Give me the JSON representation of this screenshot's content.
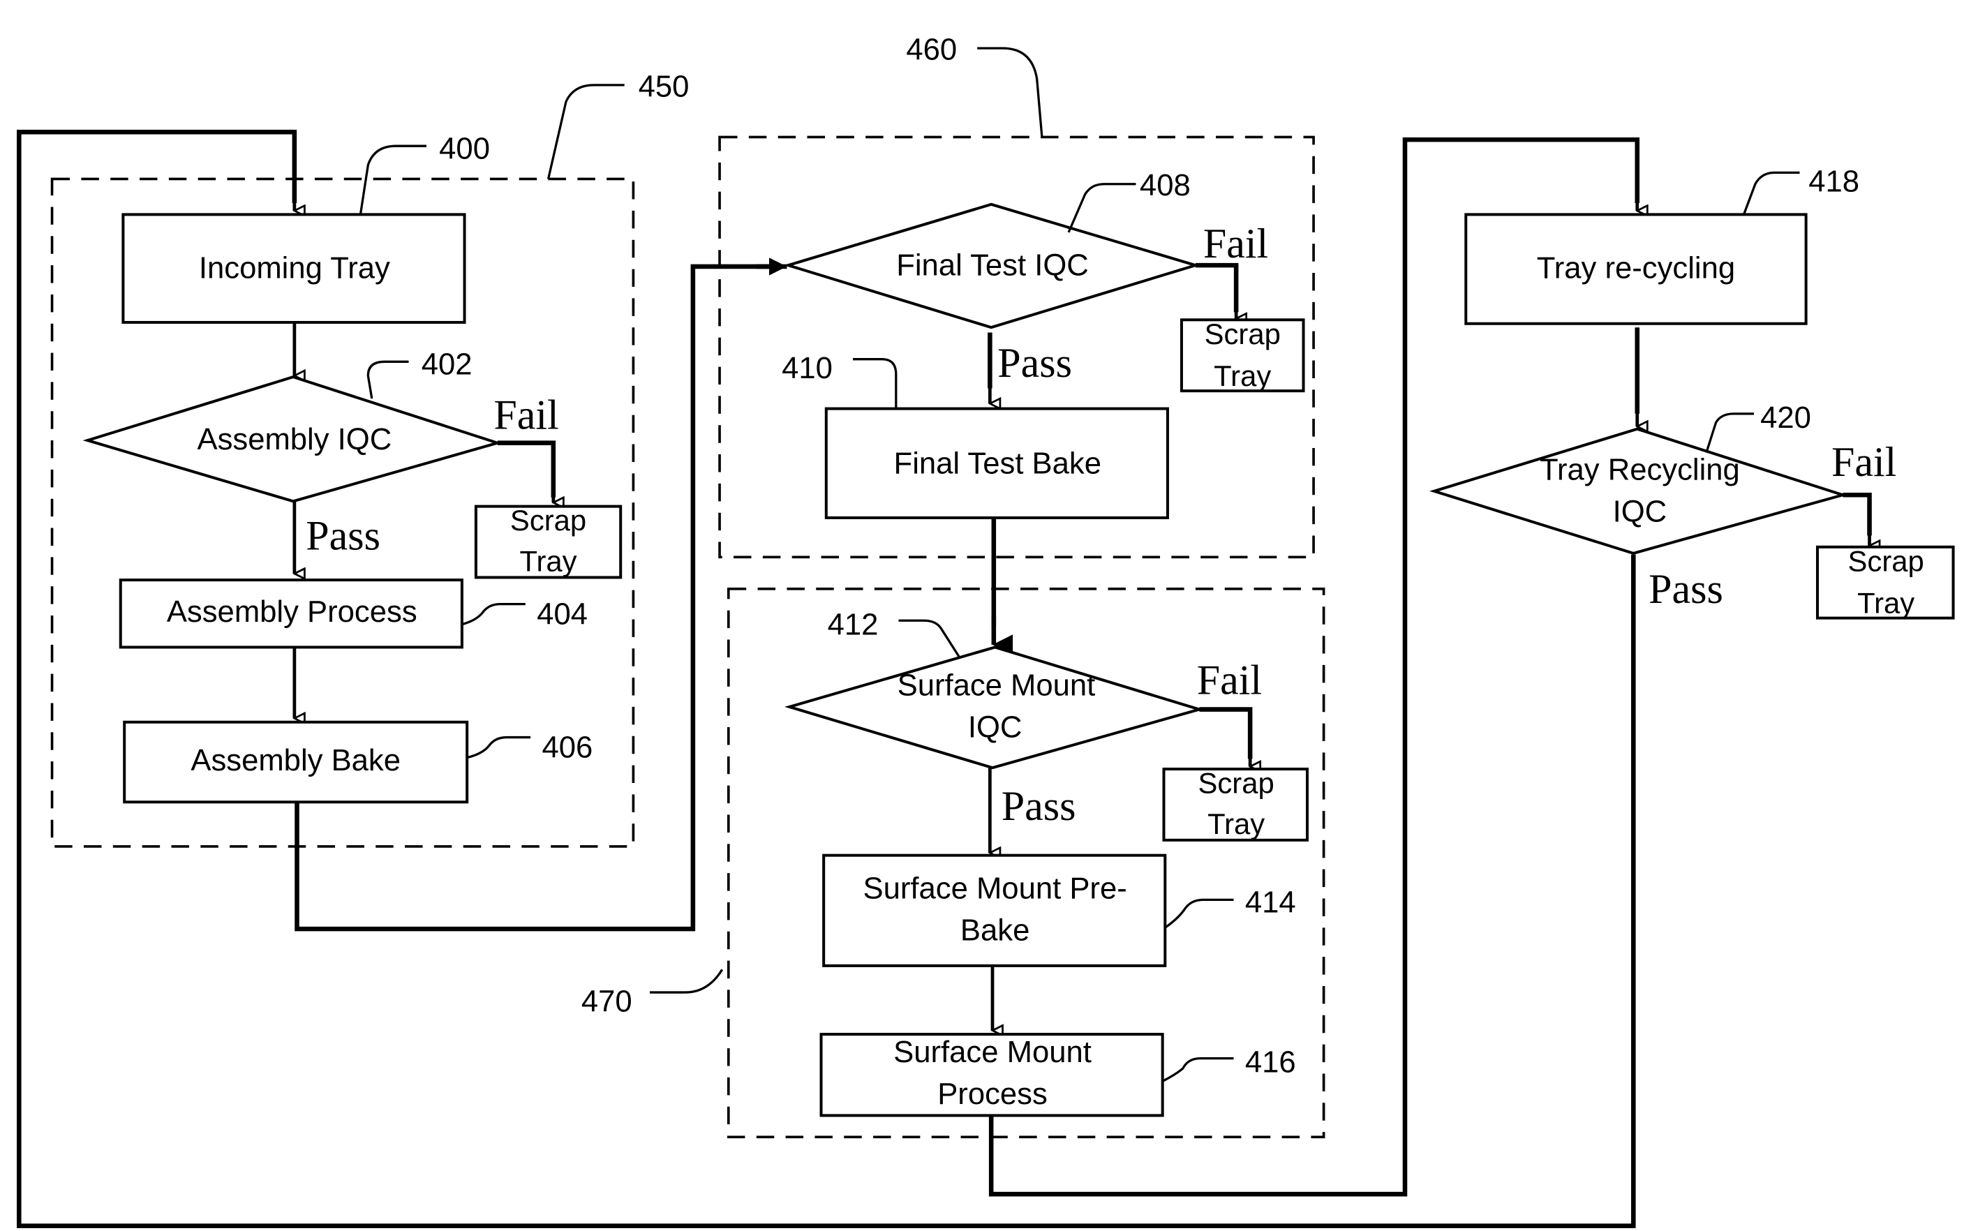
{
  "diagram": {
    "type": "flowchart",
    "groups": [
      {
        "id": "450",
        "label": "450"
      },
      {
        "id": "460",
        "label": "460"
      },
      {
        "id": "470",
        "label": "470"
      }
    ],
    "nodes": {
      "incoming_tray": {
        "ref": "400",
        "text": "Incoming Tray"
      },
      "assembly_iqc": {
        "ref": "402",
        "text": "Assembly IQC"
      },
      "assembly_process": {
        "ref": "404",
        "text": "Assembly Process"
      },
      "assembly_bake": {
        "ref": "406",
        "text": "Assembly Bake"
      },
      "final_test_iqc": {
        "ref": "408",
        "text": "Final Test IQC"
      },
      "final_test_bake": {
        "ref": "410",
        "text": "Final Test Bake"
      },
      "surface_mount_iqc": {
        "ref": "412",
        "line1": "Surface Mount",
        "line2": "IQC"
      },
      "surface_mount_prebake": {
        "ref": "414",
        "line1": "Surface Mount Pre-",
        "line2": "Bake"
      },
      "surface_mount_process": {
        "ref": "416",
        "line1": "Surface Mount",
        "line2": "Process"
      },
      "tray_recycling": {
        "ref": "418",
        "text": "Tray re-cycling"
      },
      "tray_recycling_iqc": {
        "ref": "420",
        "line1": "Tray Recycling",
        "line2": "IQC"
      }
    },
    "scrap": {
      "line1": "Scrap",
      "line2": "Tray"
    },
    "edge_labels": {
      "pass": "Pass",
      "fail": "Fail"
    }
  }
}
